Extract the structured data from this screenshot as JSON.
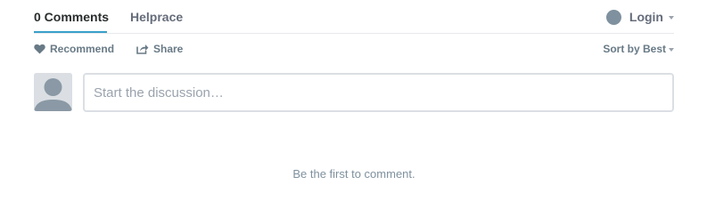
{
  "nav": {
    "comments_tab": "0 Comments",
    "community_tab": "Helprace",
    "login_label": "Login"
  },
  "actions": {
    "recommend_label": "Recommend",
    "share_label": "Share",
    "sort_label": "Sort by Best"
  },
  "composer": {
    "placeholder": "Start the discussion…"
  },
  "empty_state": {
    "message": "Be the first to comment."
  },
  "icons": {
    "recommend": "heart-icon",
    "share": "share-icon",
    "login": "user-avatar-icon",
    "dropdown": "caret-down-icon"
  },
  "colors": {
    "accent": "#39a0c9",
    "muted_text": "#687a86",
    "avatar_gray": "#7f919e"
  }
}
